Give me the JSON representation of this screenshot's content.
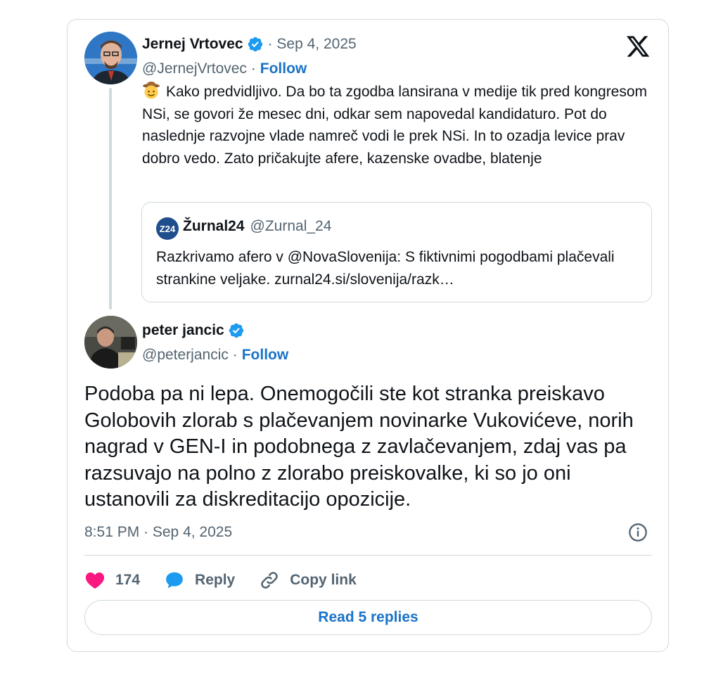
{
  "tweet1": {
    "author_name": "Jernej Vrtovec",
    "date": "· Sep 4, 2025",
    "handle": "@JernejVrtovec ·",
    "follow_label": "Follow",
    "emoji": "cowboy-face-emoji",
    "text": "Kako predvidljivo. Da bo ta zgodba lansirana v medije tik pred kongresom NSi, se govori že mesec dni, odkar sem napovedal kandidaturo. Pot do naslednje razvojne vlade namreč vodi le prek NSi. In to ozadja levice prav dobro vedo. Zato pričakujte afere, kazenske ovadbe, blatenje"
  },
  "quote": {
    "logo_text": "Z24",
    "name": "Žurnal24",
    "handle": "@Zurnal_24",
    "text": "Razkrivamo afero v @NovaSlovenija: S fiktivnimi pogodbami plačevali strankine veljake. zurnal24.si/slovenija/razk…"
  },
  "tweet2": {
    "author_name": "peter jancic",
    "handle": "@peterjancic ·",
    "follow_label": "Follow",
    "text": "Podoba pa ni lepa. Onemogočili ste kot stranka preiskavo Golobovih zlorab s plačevanjem novinarke Vukovićeve, norih nagrad v GEN-I in podobnega z zavlačevanjem, zdaj vas pa razsuvajo na polno z zlorabo preiskovalke, ki so jo oni ustanovili za diskreditacijo opozicije.",
    "timestamp": "8:51 PM · Sep 4, 2025"
  },
  "actions": {
    "like_count": "174",
    "reply_label": "Reply",
    "copy_link_label": "Copy link"
  },
  "read_replies_label": "Read 5 replies",
  "colors": {
    "accent": "#1d9bf0",
    "link": "#1a73c8",
    "like": "#f91880",
    "muted": "#536471",
    "border": "#cfd9de"
  },
  "icons": [
    "verified-badge-icon",
    "x-logo-icon",
    "info-icon",
    "heart-icon",
    "reply-bubble-icon",
    "link-icon"
  ]
}
